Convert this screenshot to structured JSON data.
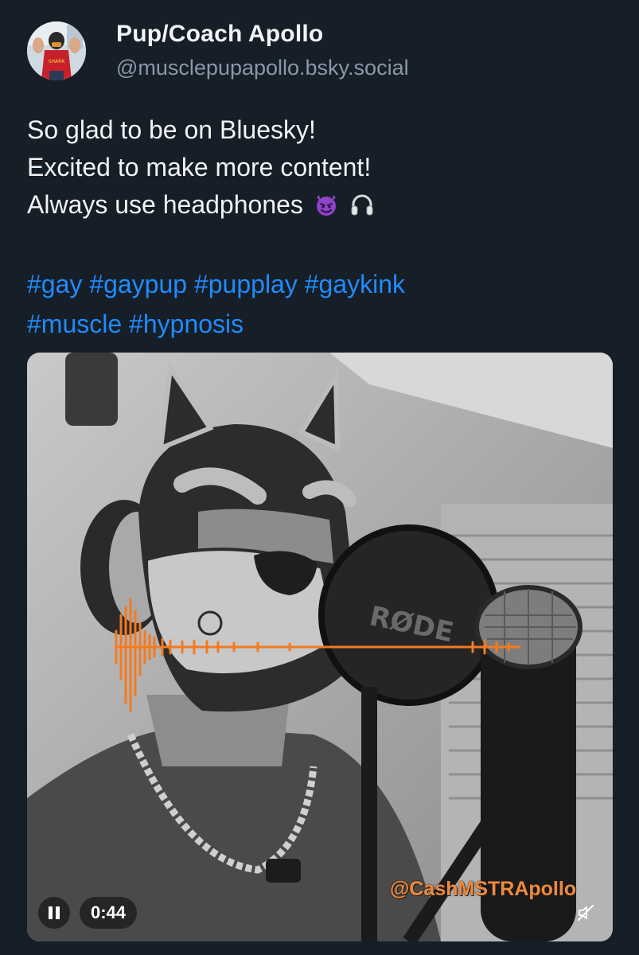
{
  "author": {
    "name": "Pup/Coach Apollo",
    "handle": "@musclepupapollo.bsky.social",
    "avatar_icon": "avatar-photo"
  },
  "post": {
    "lines": [
      "So glad to be on Bluesky!",
      "Excited to make more content!",
      "Always use headphones"
    ],
    "emojis": [
      "smiling-devil-icon",
      "headphones-icon"
    ],
    "hashtags": [
      "#gay",
      "#gaypup",
      "#pupplay",
      "#gaykink",
      "#muscle",
      "#hypnosis"
    ]
  },
  "video": {
    "watermark": "@CashMSTRApollo",
    "time": "0:44",
    "play_state": "playing",
    "muted": true,
    "accent_color": "#f47a20"
  },
  "colors": {
    "background": "#161e27",
    "link": "#208bfe",
    "handle": "#8b98a8"
  }
}
